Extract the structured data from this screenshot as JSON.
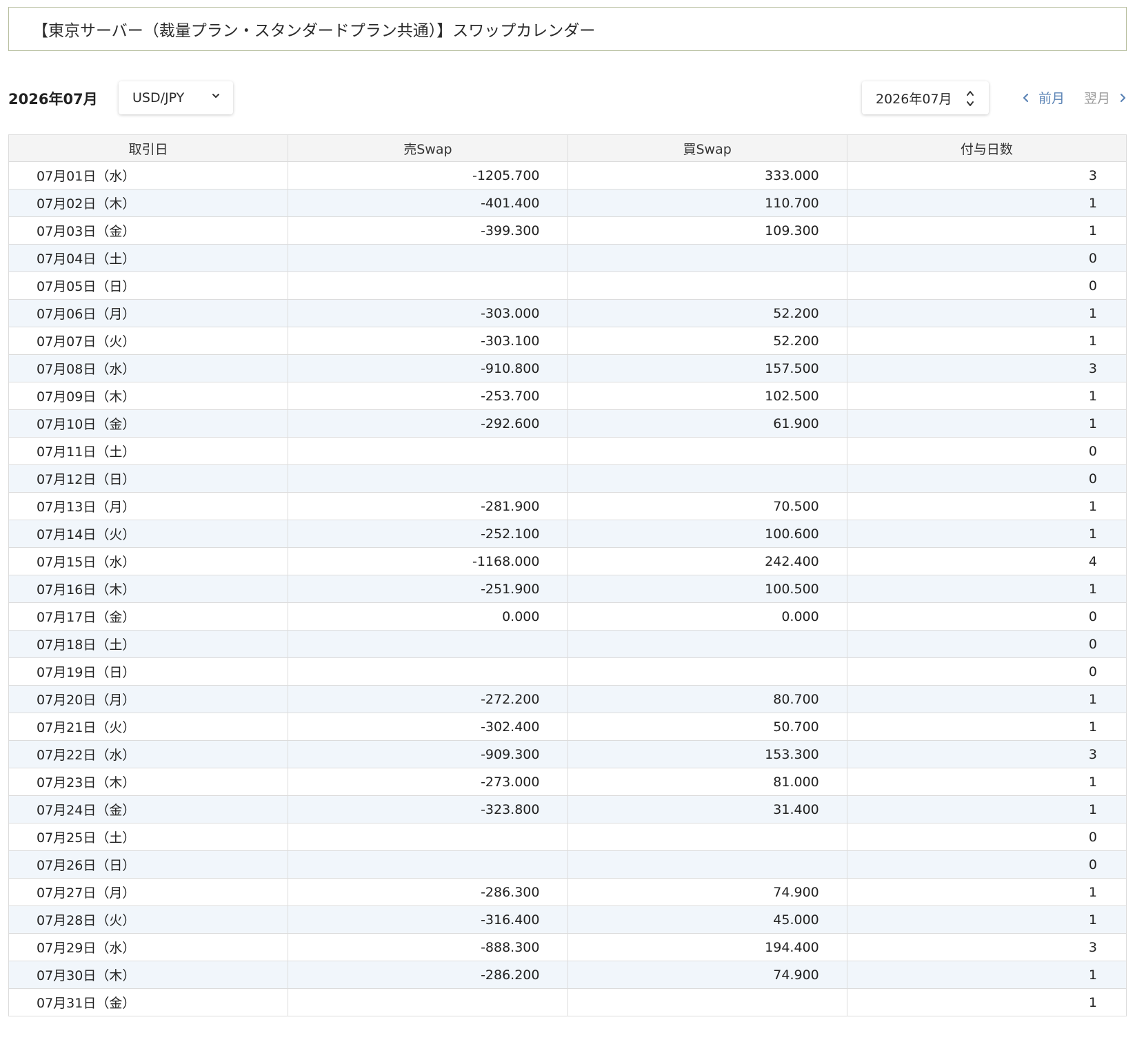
{
  "page_title": "【東京サーバー（裁量プラン・スタンダードプラン共通）】スワップカレンダー",
  "toolbar": {
    "month_label": "2026年07月",
    "pair_value": "USD/JPY",
    "date_value": "2026年07月",
    "prev_label": "前月",
    "next_label": "翌月"
  },
  "table": {
    "headers": [
      "取引日",
      "売Swap",
      "買Swap",
      "付与日数"
    ],
    "rows": [
      {
        "date": "07月01日（水）",
        "sell": "-1205.700",
        "buy": "333.000",
        "days": "3"
      },
      {
        "date": "07月02日（木）",
        "sell": "-401.400",
        "buy": "110.700",
        "days": "1"
      },
      {
        "date": "07月03日（金）",
        "sell": "-399.300",
        "buy": "109.300",
        "days": "1"
      },
      {
        "date": "07月04日（土）",
        "sell": "",
        "buy": "",
        "days": "0"
      },
      {
        "date": "07月05日（日）",
        "sell": "",
        "buy": "",
        "days": "0"
      },
      {
        "date": "07月06日（月）",
        "sell": "-303.000",
        "buy": "52.200",
        "days": "1"
      },
      {
        "date": "07月07日（火）",
        "sell": "-303.100",
        "buy": "52.200",
        "days": "1"
      },
      {
        "date": "07月08日（水）",
        "sell": "-910.800",
        "buy": "157.500",
        "days": "3"
      },
      {
        "date": "07月09日（木）",
        "sell": "-253.700",
        "buy": "102.500",
        "days": "1"
      },
      {
        "date": "07月10日（金）",
        "sell": "-292.600",
        "buy": "61.900",
        "days": "1"
      },
      {
        "date": "07月11日（土）",
        "sell": "",
        "buy": "",
        "days": "0"
      },
      {
        "date": "07月12日（日）",
        "sell": "",
        "buy": "",
        "days": "0"
      },
      {
        "date": "07月13日（月）",
        "sell": "-281.900",
        "buy": "70.500",
        "days": "1"
      },
      {
        "date": "07月14日（火）",
        "sell": "-252.100",
        "buy": "100.600",
        "days": "1"
      },
      {
        "date": "07月15日（水）",
        "sell": "-1168.000",
        "buy": "242.400",
        "days": "4"
      },
      {
        "date": "07月16日（木）",
        "sell": "-251.900",
        "buy": "100.500",
        "days": "1"
      },
      {
        "date": "07月17日（金）",
        "sell": "0.000",
        "buy": "0.000",
        "days": "0"
      },
      {
        "date": "07月18日（土）",
        "sell": "",
        "buy": "",
        "days": "0"
      },
      {
        "date": "07月19日（日）",
        "sell": "",
        "buy": "",
        "days": "0"
      },
      {
        "date": "07月20日（月）",
        "sell": "-272.200",
        "buy": "80.700",
        "days": "1"
      },
      {
        "date": "07月21日（火）",
        "sell": "-302.400",
        "buy": "50.700",
        "days": "1"
      },
      {
        "date": "07月22日（水）",
        "sell": "-909.300",
        "buy": "153.300",
        "days": "3"
      },
      {
        "date": "07月23日（木）",
        "sell": "-273.000",
        "buy": "81.000",
        "days": "1"
      },
      {
        "date": "07月24日（金）",
        "sell": "-323.800",
        "buy": "31.400",
        "days": "1"
      },
      {
        "date": "07月25日（土）",
        "sell": "",
        "buy": "",
        "days": "0"
      },
      {
        "date": "07月26日（日）",
        "sell": "",
        "buy": "",
        "days": "0"
      },
      {
        "date": "07月27日（月）",
        "sell": "-286.300",
        "buy": "74.900",
        "days": "1"
      },
      {
        "date": "07月28日（火）",
        "sell": "-316.400",
        "buy": "45.000",
        "days": "1"
      },
      {
        "date": "07月29日（水）",
        "sell": "-888.300",
        "buy": "194.400",
        "days": "3"
      },
      {
        "date": "07月30日（木）",
        "sell": "-286.200",
        "buy": "74.900",
        "days": "1"
      },
      {
        "date": "07月31日（金）",
        "sell": "",
        "buy": "",
        "days": "1"
      }
    ]
  },
  "icons": {
    "pair_select": "chevron-down-icon",
    "date_spinner": "up-down-arrows-icon",
    "prev": "chevron-left-icon",
    "next": "chevron-right-icon"
  },
  "colors": {
    "title_border": "#b8bfa0",
    "stripe": "#f1f6fb",
    "header_bg": "#f4f4f4",
    "link_active": "#5a83b5",
    "link_inactive": "#9a9a9a"
  }
}
